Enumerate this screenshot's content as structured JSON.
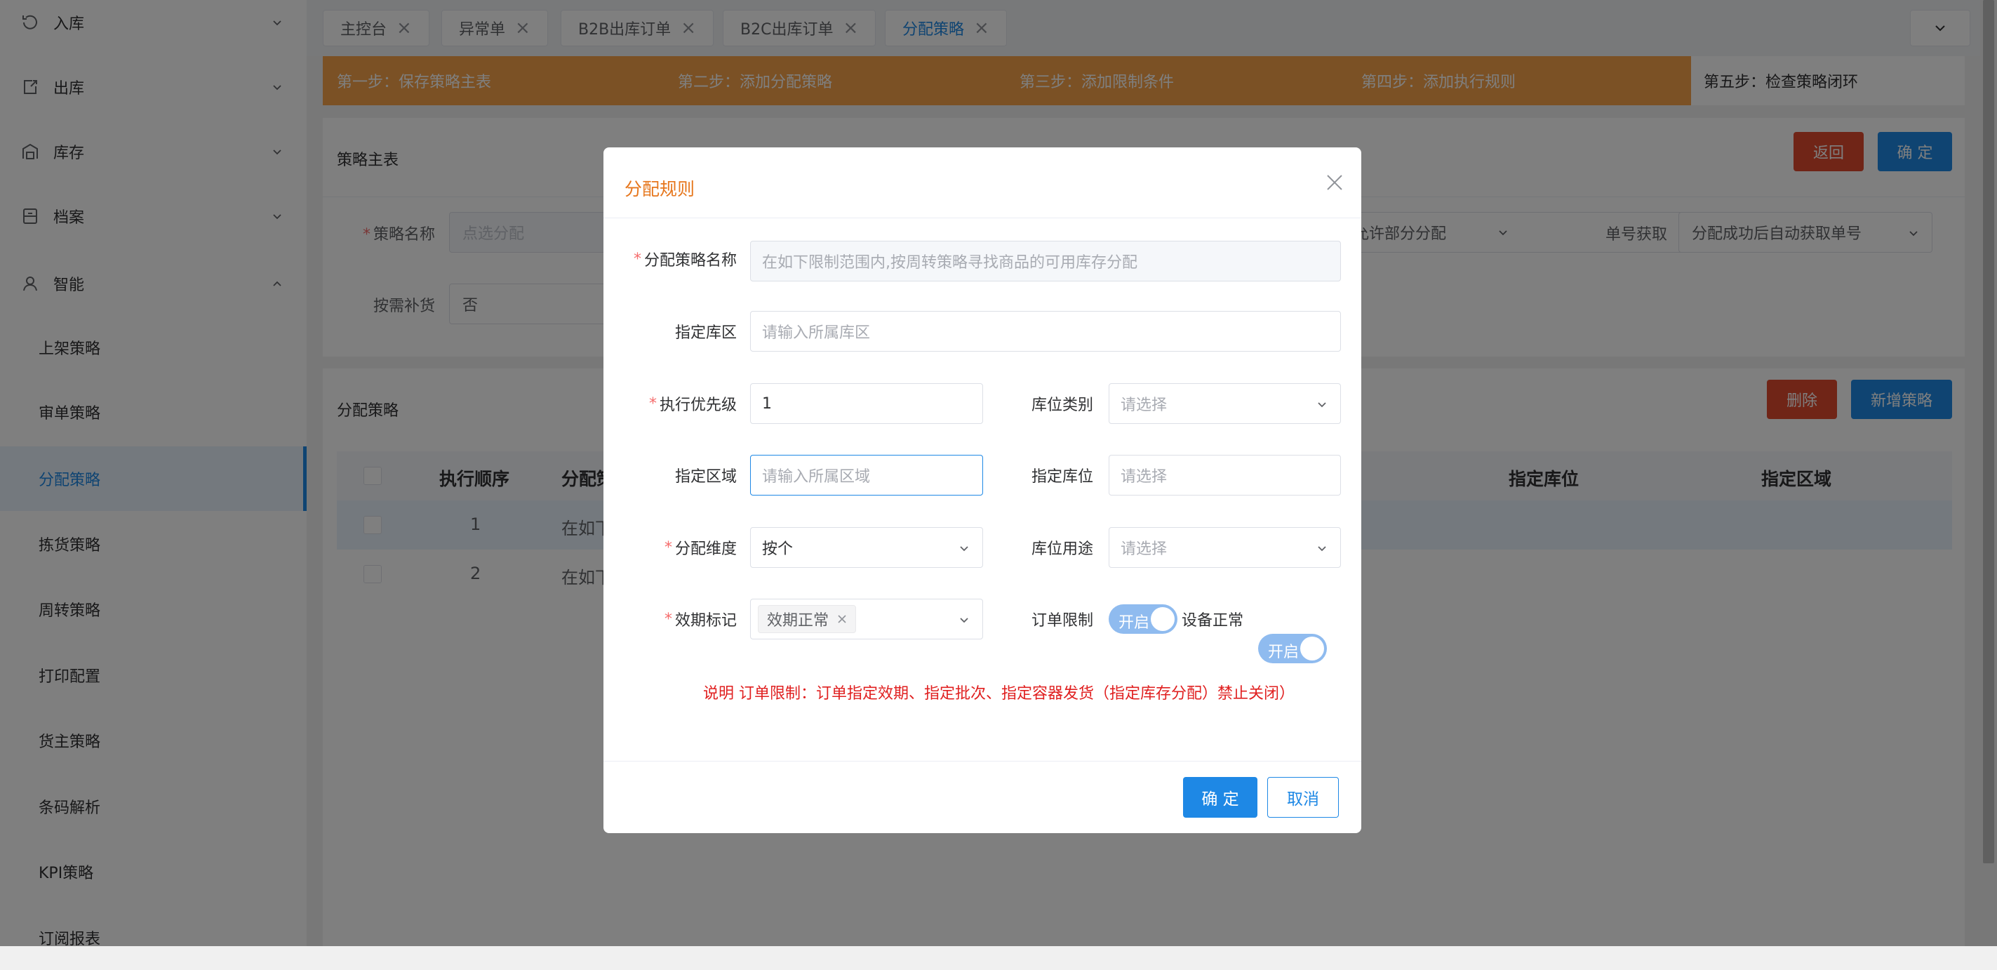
{
  "sidebar": {
    "menus": [
      {
        "label": "入库",
        "icon": "inbound-icon",
        "expanded": false
      },
      {
        "label": "出库",
        "icon": "outbound-icon",
        "expanded": false
      },
      {
        "label": "库存",
        "icon": "warehouse-icon",
        "expanded": false
      },
      {
        "label": "档案",
        "icon": "archive-icon",
        "expanded": false
      },
      {
        "label": "智能",
        "icon": "smart-icon",
        "expanded": true
      }
    ],
    "submenu": [
      {
        "label": "上架策略",
        "active": false
      },
      {
        "label": "审单策略",
        "active": false
      },
      {
        "label": "分配策略",
        "active": true
      },
      {
        "label": "拣货策略",
        "active": false
      },
      {
        "label": "周转策略",
        "active": false
      },
      {
        "label": "打印配置",
        "active": false
      },
      {
        "label": "货主策略",
        "active": false
      },
      {
        "label": "条码解析",
        "active": false
      },
      {
        "label": "KPI策略",
        "active": false
      },
      {
        "label": "订阅报表",
        "active": false
      }
    ]
  },
  "tabs": [
    {
      "label": "主控台",
      "active": false
    },
    {
      "label": "异常单",
      "active": false
    },
    {
      "label": "B2B出库订单",
      "active": false
    },
    {
      "label": "B2C出库订单",
      "active": false
    },
    {
      "label": "分配策略",
      "active": true
    }
  ],
  "steps": [
    "第一步：保存策略主表",
    "第二步：添加分配策略",
    "第三步：添加限制条件",
    "第四步：添加执行规则",
    "第五步：检查策略闭环"
  ],
  "master_panel": {
    "title": "策略主表",
    "back_label": "返回",
    "confirm_label": "确 定",
    "name_label": "策略名称",
    "name_placeholder": "点选分配",
    "partial_value": "允许部分分配",
    "order_no_label": "单号获取",
    "order_no_value": "分配成功后自动获取单号",
    "replenish_label": "按需补货",
    "replenish_value": "否"
  },
  "strategy_panel": {
    "title": "分配策略",
    "delete_label": "删除",
    "add_label": "新增策略",
    "columns": [
      "执行顺序",
      "分配策",
      "指定库位",
      "指定区域"
    ],
    "rows": [
      {
        "order": "1",
        "name": "在如下"
      },
      {
        "order": "2",
        "name": "在如下"
      }
    ]
  },
  "dialog": {
    "title": "分配规则",
    "fields": {
      "strategy_name_label": "分配策略名称",
      "strategy_name_value": "在如下限制范围内,按周转策略寻找商品的可用库存分配",
      "zone_label": "指定库区",
      "zone_placeholder": "请输入所属库区",
      "priority_label": "执行优先级",
      "priority_value": "1",
      "location_type_label": "库位类别",
      "location_type_placeholder": "请选择",
      "area_label": "指定区域",
      "area_placeholder": "请输入所属区域",
      "location_label": "指定库位",
      "location_placeholder": "请选择",
      "dimension_label": "分配维度",
      "dimension_value": "按个",
      "usage_label": "库位用途",
      "usage_placeholder": "请选择",
      "expiry_label": "效期标记",
      "expiry_tag": "效期正常",
      "order_limit_label": "订单限制",
      "order_limit_switch": "开启",
      "device_label": "设备正常",
      "device_switch": "开启"
    },
    "note": "说明   订单限制：订单指定效期、指定批次、指定容器发货（指定库存分配）禁止关闭）",
    "confirm_label": "确 定",
    "cancel_label": "取消"
  },
  "colors": {
    "accent": "#1e88e5",
    "step_bar": "#f6a34a",
    "danger": "#e14a2f",
    "title_orange": "#e6761c",
    "note_red": "#e02020"
  }
}
